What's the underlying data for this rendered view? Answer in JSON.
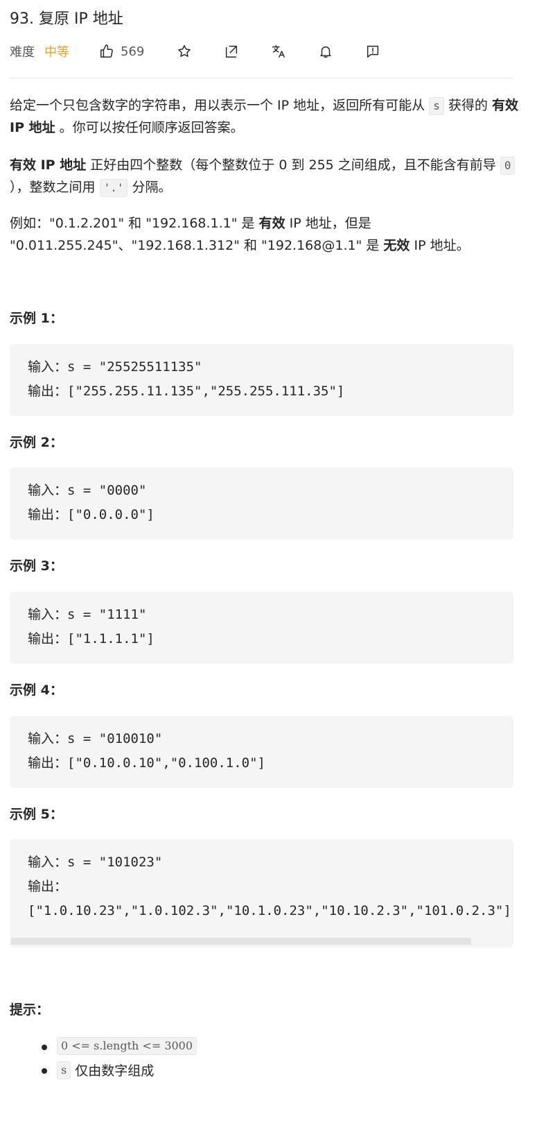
{
  "problem": {
    "title": "93. 复原 IP 地址",
    "difficulty_label": "难度",
    "difficulty_value": "中等",
    "like_count": "569"
  },
  "icons": {
    "like": "thumbs-up-icon",
    "favorite": "star-icon",
    "share": "share-icon",
    "translate": "translate-icon",
    "notify": "bell-icon",
    "feedback": "feedback-icon"
  },
  "colors": {
    "difficulty": "#f0a020",
    "code_bg": "#f5f5f5",
    "text": "#262626"
  },
  "description": {
    "p1_part1": "给定一个只包含数字的字符串，用以表示一个 IP 地址，返回所有可能从",
    "p1_code": "s",
    "p1_part2": "获得的",
    "p1_bold": "有效 IP 地址",
    "p1_part3": "。你可以按任何顺序返回答案。",
    "p2_bold": "有效 IP 地址",
    "p2_part1": "正好由四个整数（每个整数位于 0 到 255 之间组成，且不能含有前导",
    "p2_code1": "0",
    "p2_part2": "），整数之间用",
    "p2_code2": "'.'",
    "p2_part3": "分隔。",
    "p3_part1": "例如：\"0.1.2.201\" 和 \"192.168.1.1\" 是",
    "p3_bold1": "有效",
    "p3_part2": "IP 地址，但是 \"0.011.255.245\"、\"192.168.1.312\" 和 \"192.168@1.1\" 是",
    "p3_bold2": "无效",
    "p3_part3": "IP 地址。"
  },
  "examples": [
    {
      "title": "示例 1：",
      "lines": [
        "输入：s = \"25525511135\"",
        "输出：[\"255.255.11.135\",\"255.255.111.35\"]"
      ]
    },
    {
      "title": "示例 2：",
      "lines": [
        "输入：s = \"0000\"",
        "输出：[\"0.0.0.0\"]"
      ]
    },
    {
      "title": "示例 3：",
      "lines": [
        "输入：s = \"1111\"",
        "输出：[\"1.1.1.1\"]"
      ]
    },
    {
      "title": "示例 4：",
      "lines": [
        "输入：s = \"010010\"",
        "输出：[\"0.10.0.10\",\"0.100.1.0\"]"
      ]
    },
    {
      "title": "示例 5：",
      "lines": [
        "输入：s = \"101023\"",
        "输出：",
        "[\"1.0.10.23\",\"1.0.102.3\",\"10.1.0.23\",\"10.10.2.3\",\"101.0.2.3\"]"
      ]
    }
  ],
  "hints": {
    "title": "提示：",
    "items": [
      {
        "code": "0 <= s.length <= 3000",
        "text": ""
      },
      {
        "code": "s",
        "text": "仅由数字组成"
      }
    ]
  }
}
